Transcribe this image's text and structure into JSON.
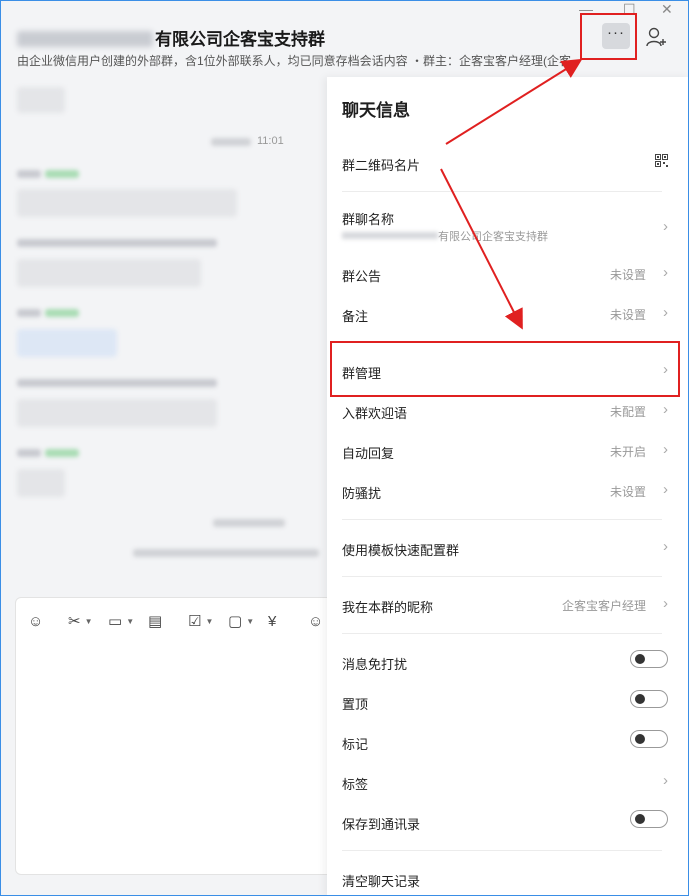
{
  "header": {
    "title_visible": "有限公司企客宝支持群",
    "subtitle": "由企业微信用户创建的外部群，含1位外部联系人，均已同意存档会话内容 ・群主：企客宝客户经理(企客...",
    "more_glyph": "···",
    "adduser_glyph": "⁺"
  },
  "window_controls": {
    "min": "—",
    "max": "☐",
    "close": "✕"
  },
  "chat": {
    "timestamp": "11:01"
  },
  "input": {
    "tool_glyphs": [
      "☺",
      "✂",
      "▭",
      "▤",
      "☑",
      "▢",
      "¥",
      "☺"
    ]
  },
  "panel": {
    "title": "聊天信息",
    "qr_label": "群二维码名片",
    "group_name_label": "群聊名称",
    "group_name_value": "有限公司企客宝支持群",
    "announcement_label": "群公告",
    "announcement_value": "未设置",
    "remark_label": "备注",
    "remark_value": "未设置",
    "manage_label": "群管理",
    "welcome_label": "入群欢迎语",
    "welcome_value": "未配置",
    "autoreply_label": "自动回复",
    "autoreply_value": "未开启",
    "antispam_label": "防骚扰",
    "antispam_value": "未设置",
    "template_label": "使用模板快速配置群",
    "nickname_label": "我在本群的昵称",
    "nickname_value": "企客宝客户经理",
    "mute_label": "消息免打扰",
    "pin_label": "置顶",
    "mark_label": "标记",
    "tag_label": "标签",
    "save_label": "保存到通讯录",
    "clear_label": "清空聊天记录",
    "chevron": "›"
  },
  "colors": {
    "annotation_red": "#e02020",
    "accent_border": "#3a8ee6"
  }
}
